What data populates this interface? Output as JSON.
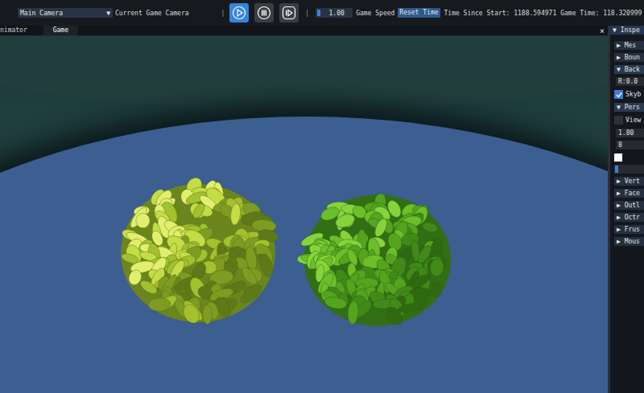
{
  "toolbar": {
    "camera_select": {
      "value": "Main Camera",
      "arrow": "▼"
    },
    "camera_label": "Current Game Camera",
    "separators": [
      "|",
      "|"
    ],
    "playback": [
      {
        "kind": "play",
        "selected": true
      },
      {
        "kind": "pause",
        "selected": false
      },
      {
        "kind": "step",
        "selected": false
      }
    ],
    "game_speed": {
      "value": "1.00",
      "level": 0.08,
      "label": "Game Speed"
    },
    "reset_button": "Reset Time",
    "time_since_start": "Time Since Start: 1188.594971",
    "game_time": "Game Time: 118.320999"
  },
  "tabs": [
    {
      "label": "nimator",
      "selected": false
    },
    {
      "label": "Game",
      "selected": true
    }
  ],
  "close": "×",
  "inspector": {
    "arrow": "▼",
    "title": "Inspe",
    "rows": [
      {
        "kind": "section",
        "arrow": "▶",
        "label": "Mes",
        "expanded": false
      },
      {
        "kind": "section",
        "arrow": "▶",
        "label": "Boun",
        "expanded": false
      },
      {
        "kind": "section",
        "arrow": "▼",
        "label": "Back",
        "expanded": true
      },
      {
        "kind": "field",
        "value": "R:0.0"
      },
      {
        "kind": "checkbox",
        "label": "Skyb",
        "checked": true
      },
      {
        "kind": "section",
        "arrow": "▼",
        "label": "Pers",
        "expanded": true
      },
      {
        "kind": "checkbox",
        "label": "View",
        "checked": false
      },
      {
        "kind": "field",
        "value": "1.80"
      },
      {
        "kind": "field",
        "value": "8"
      },
      {
        "kind": "swatch",
        "color": "#ffffff"
      },
      {
        "kind": "slider",
        "level": 0.12
      },
      {
        "kind": "section",
        "arrow": "▶",
        "label": "Vert",
        "expanded": false
      },
      {
        "kind": "section",
        "arrow": "▶",
        "label": "Face",
        "expanded": false
      },
      {
        "kind": "section",
        "arrow": "▶",
        "label": "Outl",
        "expanded": false
      },
      {
        "kind": "section",
        "arrow": "▶",
        "label": "Octr",
        "expanded": false
      },
      {
        "kind": "section",
        "arrow": "▶",
        "label": "Frus",
        "expanded": false
      },
      {
        "kind": "section",
        "arrow": "▶",
        "label": "Mous",
        "expanded": false
      }
    ]
  }
}
